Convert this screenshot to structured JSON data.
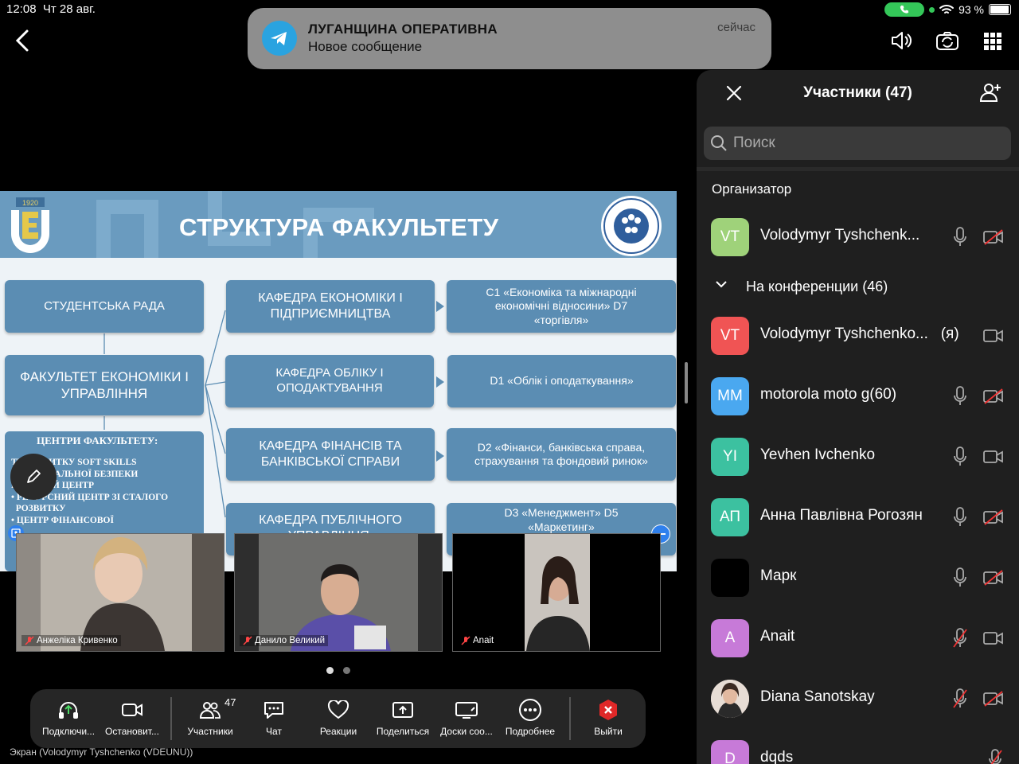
{
  "status_bar": {
    "time": "12:08",
    "date": "Чт 28 авг.",
    "battery": "93 %"
  },
  "notification": {
    "app": "ЛУГАНЩИНА ОПЕРАТИВНА",
    "message": "Новое сообщение",
    "time": "сейчас"
  },
  "slide": {
    "title": "СТРУКТУРА ФАКУЛЬТЕТУ",
    "left_boxes": [
      "СТУДЕНТСЬКА РАДА",
      "ФАКУЛЬТЕТ ЕКОНОМІКИ І УПРАВЛІННЯ"
    ],
    "centers_title": "ЦЕНТРИ ФАКУЛЬТЕТУ:",
    "centers_items": "ТР РОЗВИТКУ SOFT SKILLS\nР РЕГІОНАЛЬНОЇ БЕЗПЕКИ\nИТИЧНИЙ ЦЕНТР\n• РЕСУРСНИЙ ЦЕНТР ЗІ СТАЛОГО\n  РОЗВИТКУ\n• ЦЕНТР ФІНАНСОВОЇ",
    "departments": [
      "КАФЕДРА ЕКОНОМІКИ І ПІДПРИЄМНИЦТВА",
      "КАФЕДРА ОБЛІКУ І ОПОДАКТУВАННЯ",
      "КАФЕДРА ФІНАНСІВ ТА БАНКІВСЬКОЇ СПРАВИ",
      "КАФЕДРА ПУБЛІЧНОГО УПРАВЛІННЯ, МЕНЕДЖМЕНТУ"
    ],
    "specialties": [
      "С1 «Економіка та міжнародні економічні відносини» D7 «торгівля»",
      "D1 «Облік і оподаткування»",
      "D2 «Фінанси, банківська справа, страхування та фондовий ринок»",
      "D3 «Менеджмент» D5 «Маркетинг»"
    ],
    "logo_year": "1920"
  },
  "videos": [
    {
      "name": "Анжеліка Кривенко"
    },
    {
      "name": "Данило Великий"
    },
    {
      "name": "Anait"
    }
  ],
  "toolbar": {
    "connect": "Подключи...",
    "stop": "Остановит...",
    "participants": "Участники",
    "participants_count": "47",
    "chat": "Чат",
    "reactions": "Реакции",
    "share": "Поделиться",
    "boards": "Доски соо...",
    "more": "Подробнее",
    "leave": "Выйти"
  },
  "screen_label": "Экран (Volodymyr Tyshchenko (VDEUNU))",
  "panel": {
    "title": "Участники (47)",
    "search_placeholder": "Поиск",
    "organizer_label": "Организатор",
    "in_conference_label": "На конференции (46)",
    "organizer": {
      "initials": "VT",
      "name": "Volodymyr Tyshchenk...",
      "color": "#9fd27a"
    },
    "participants": [
      {
        "initials": "VT",
        "name": "Volodymyr Tyshchenko...",
        "suffix": "(я)",
        "color": "#f05454"
      },
      {
        "initials": "MM",
        "name": "motorola moto g(60)",
        "color": "#4aa8f0"
      },
      {
        "initials": "YI",
        "name": "Yevhen Ivchenko",
        "color": "#3cc1a0"
      },
      {
        "initials": "АП",
        "name": "Анна Павлівна Рогозян",
        "color": "#3cc1a0"
      },
      {
        "initials": "",
        "name": "Марк",
        "color": "#000000"
      },
      {
        "initials": "A",
        "name": "Anait",
        "color": "#c77ad8"
      },
      {
        "initials": "",
        "name": "Diana Sanotskay",
        "color": "#d8c0b0"
      },
      {
        "initials": "D",
        "name": "dqds",
        "color": "#c77ad8"
      }
    ]
  }
}
